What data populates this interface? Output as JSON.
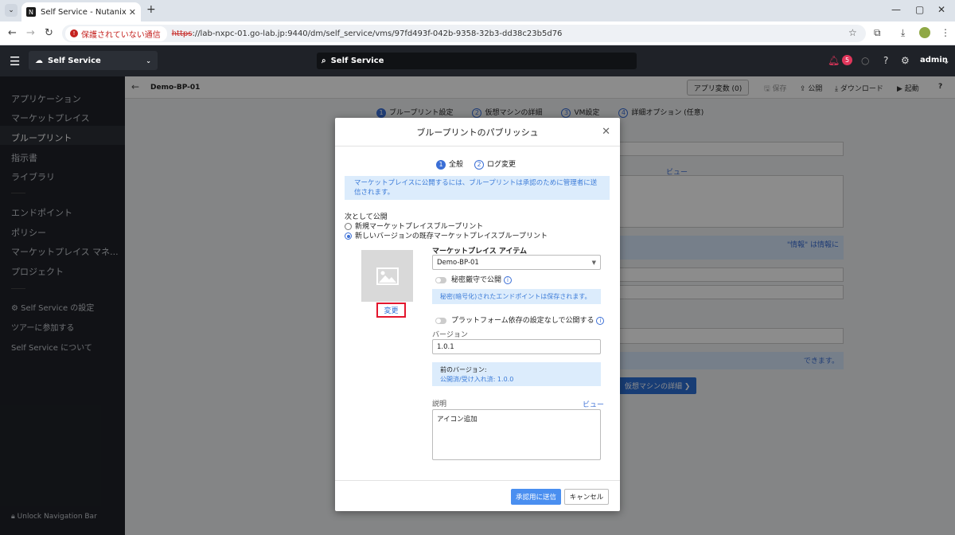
{
  "browser": {
    "tab_title": "Self Service - Nutanix",
    "security_label": "保護されていない通信",
    "url_scheme": "https",
    "url_rest": "://lab-nxpc-01.go-lab.jp:9440/dm/self_service/vms/97fd493f-042b-9358-32b3-dd38c23b5d76"
  },
  "header": {
    "app_name": "Self Service",
    "search_text": "Self Service",
    "alert_count": "5",
    "user": "admin"
  },
  "sidebar": {
    "items": [
      "アプリケーション",
      "マーケットプレイス",
      "ブループリント",
      "指示書",
      "ライブラリ",
      "エンドポイント",
      "ポリシー",
      "マーケットプレイス マネ...",
      "プロジェクト",
      "Self Service の設定",
      "ツアーに参加する",
      "Self Service について"
    ],
    "unlock": "Unlock Navigation Bar"
  },
  "main": {
    "breadcrumb": "Demo-BP-01",
    "app_vars": "アプリ変数 (0)",
    "save": "保存",
    "publish": "公開",
    "download": "ダウンロード",
    "launch": "起動",
    "help": "?",
    "steps": [
      "ブループリント設定",
      "仮想マシンの詳細",
      "VM設定",
      "詳細オプション (任意)"
    ],
    "bg_view": "ビュー",
    "bg_info": "\"情報\" は情報に",
    "bg_info2": "できます。",
    "bg_next": "仮想マシンの詳細 ❯"
  },
  "modal": {
    "title": "ブループリントのパブリッシュ",
    "step1": "全般",
    "step2": "ログ変更",
    "info": "マーケットプレイスに公開するには、ブループリントは承認のために管理者に送信されます。",
    "publish_as": "次として公開",
    "opt_new": "新規マーケットプレイスブループリント",
    "opt_existing": "新しいバージョンの既存マーケットプレイスブループリント",
    "change": "変更",
    "mp_item_label": "マーケットプレイス アイテム",
    "mp_item_value": "Demo-BP-01",
    "secret_toggle": "秘密厳守で公開",
    "secret_note": "秘密(暗号化)されたエンドポイントは保存されます。",
    "platform_toggle": "プラットフォーム依存の設定なしで公開する",
    "version_label": "バージョン",
    "version_value": "1.0.1",
    "prev_label": "前のバージョン:",
    "prev_value": "公開済/受け入れ済: 1.0.0",
    "desc_label": "説明",
    "desc_view": "ビュー",
    "desc_value": "アイコン追加",
    "submit": "承認用に送信",
    "cancel": "キャンセル"
  }
}
